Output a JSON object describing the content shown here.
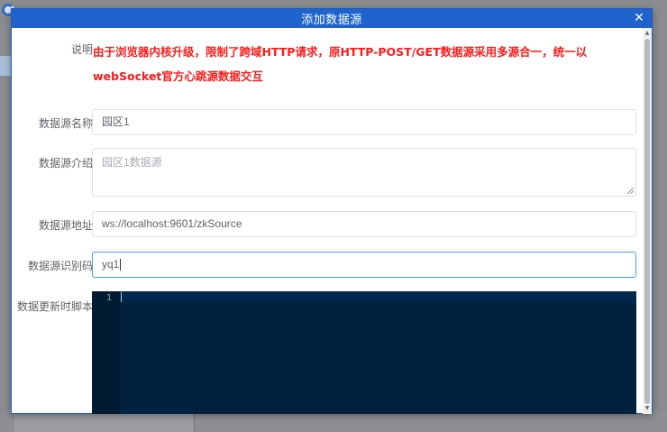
{
  "modal": {
    "title": "添加数据源",
    "close_symbol": "✕"
  },
  "form": {
    "notice_label": "说明",
    "notice_text": "由于浏览器内核升级，限制了跨域HTTP请求，原HTTP-POST/GET数据源采用多源合一，统一以webSocket官方心跳源数据交互",
    "name_label": "数据源名称",
    "name_value": "园区1",
    "intro_label": "数据源介绍",
    "intro_placeholder": "园区1数据源",
    "address_label": "数据源地址",
    "address_value": "ws://localhost:9601/zkSource",
    "code_label": "数据源识别码",
    "code_value": "yq1",
    "script_label": "数据更新时脚本"
  },
  "editor": {
    "line_numbers": [
      "1"
    ]
  },
  "colors": {
    "header_blue": "#1f64cc",
    "notice_red": "#ff1a1a",
    "editor_bg": "#002240",
    "focus_border": "#409eff"
  }
}
